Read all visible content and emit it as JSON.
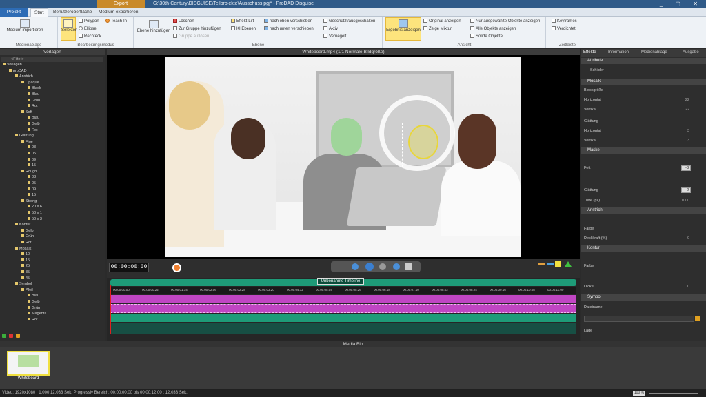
{
  "titlebar": {
    "context_tab": "Export",
    "title": "G:\\30th-Century\\DISGUISE\\Teilprojekte\\Ausschuss.pgj* - ProDAD Disguise",
    "window_controls": "_ ▢ ✕"
  },
  "tabs": [
    {
      "label": "Projekt"
    },
    {
      "label": "Start"
    },
    {
      "label": "Benutzeroberfläche"
    },
    {
      "label": "Medium exportieren"
    }
  ],
  "ribbon": {
    "media_import": "Medium importieren",
    "group_media": "Medienablage",
    "selector": "Selektor",
    "polygon": "Polygon",
    "ellipse": "Ellipse",
    "rect": "Rechteck",
    "teach": "Teach-In",
    "group_edit": "Bearbeitungsmodus",
    "add_layer": "Ebene hinzufügen",
    "delete": "Löschen",
    "group_add": "Zur Gruppe hinzufügen",
    "group_remove": "Gruppe auflösen",
    "effect_lift": "Effekt-Lift",
    "ki_layers": "KI Ebenen",
    "move_up": "nach oben verschieben",
    "move_down": "nach unten verschieben",
    "locked_hidden": "Geschützt/ausgeschalten",
    "active": "Aktiv",
    "locked": "Verriegelt",
    "group_layer": "Ebene",
    "show_result": "Ergebnis anzeigen",
    "show_original": "Original anzeigen",
    "show_mix": "Zeige Mixtur",
    "only_selected": "Nur ausgewählte Objekte anzeigen",
    "all_objects": "Alle Objekte anzeigen",
    "solo_objects": "Solide Objekte",
    "group_view": "Ansicht",
    "keyframes": "Keyframes",
    "stretch": "Verdichtet",
    "group_time": "Zeitleiste"
  },
  "left_panel": {
    "title": "Vorlagen",
    "filter": "<Filter>",
    "tree": [
      {
        "label": "Vorlagen",
        "depth": 0
      },
      {
        "label": "proDAD",
        "depth": 1
      },
      {
        "label": "Anstrich",
        "depth": 2
      },
      {
        "label": "Opaque",
        "depth": 3
      },
      {
        "label": "Black",
        "depth": 4
      },
      {
        "label": "Blau",
        "depth": 4
      },
      {
        "label": "Grün",
        "depth": 4
      },
      {
        "label": "Rot",
        "depth": 4
      },
      {
        "label": "Soft",
        "depth": 3
      },
      {
        "label": "Blau",
        "depth": 4
      },
      {
        "label": "Gelb",
        "depth": 4
      },
      {
        "label": "Rot",
        "depth": 4
      },
      {
        "label": "Glättung",
        "depth": 2
      },
      {
        "label": "Fine",
        "depth": 3
      },
      {
        "label": "03",
        "depth": 4
      },
      {
        "label": "05",
        "depth": 4
      },
      {
        "label": "09",
        "depth": 4
      },
      {
        "label": "15",
        "depth": 4
      },
      {
        "label": "Rough",
        "depth": 3
      },
      {
        "label": "03",
        "depth": 4
      },
      {
        "label": "05",
        "depth": 4
      },
      {
        "label": "09",
        "depth": 4
      },
      {
        "label": "15",
        "depth": 4
      },
      {
        "label": "Strong",
        "depth": 3
      },
      {
        "label": "20 x 6",
        "depth": 4
      },
      {
        "label": "50 x 1",
        "depth": 4
      },
      {
        "label": "50 x 3",
        "depth": 4
      },
      {
        "label": "Kontur",
        "depth": 2
      },
      {
        "label": "Gelb",
        "depth": 3
      },
      {
        "label": "Grün",
        "depth": 3
      },
      {
        "label": "Rot",
        "depth": 3
      },
      {
        "label": "Mosaik",
        "depth": 2
      },
      {
        "label": "10",
        "depth": 3
      },
      {
        "label": "15",
        "depth": 3
      },
      {
        "label": "25",
        "depth": 3
      },
      {
        "label": "35",
        "depth": 3
      },
      {
        "label": "45",
        "depth": 3
      },
      {
        "label": "Symbol",
        "depth": 2
      },
      {
        "label": "Pfeil",
        "depth": 3
      },
      {
        "label": "Blau",
        "depth": 4
      },
      {
        "label": "Gelb",
        "depth": 4
      },
      {
        "label": "Grün",
        "depth": 4
      },
      {
        "label": "Magenta",
        "depth": 4
      },
      {
        "label": "Rot",
        "depth": 4
      }
    ]
  },
  "viewer": {
    "title": "Whiteboard.mp4  (1/1  Normale-Bildgröße)",
    "timecode": "00:00:00:00"
  },
  "timeline": {
    "title": "Unbenannte Timeline",
    "ticks": [
      "00:00:00:00",
      "00:00:00:22",
      "00:00:01:14",
      "00:00:02:06",
      "00:00:02:28",
      "00:00:03:20",
      "00:00:04:12",
      "00:00:05:04",
      "00:00:05:26",
      "00:00:06:18",
      "00:00:07:10",
      "00:00:08:02",
      "00:00:08:24",
      "00:00:09:16",
      "00:00:10:08",
      "00:00:11:00"
    ]
  },
  "right_panel": {
    "tabs": [
      "Effekte",
      "Information",
      "Medienablage",
      "Ausgabe"
    ],
    "attr_header": "Attribute",
    "layer_name": "Schilder",
    "sections": {
      "mosaik": "Mosaik",
      "blocksize": "Blockgröße",
      "horizontal": "Horizontal",
      "vertical": "Vertikal",
      "smoothing": "Glättung",
      "maske": "Maske",
      "fett": "Fett",
      "glaettung": "Glättung",
      "tiefe": "Tiefe (px)",
      "anstrich": "Anstrich",
      "farbe": "Farbe",
      "deckkraft": "Deckkraft (%)",
      "kontur": "Kontur",
      "dicke": "Dicke",
      "symbol": "Symbol",
      "dateiname": "Dateiname",
      "lage": "Lage"
    },
    "values": {
      "h1": "22",
      "v1": "22",
      "h2": "3",
      "v2": "3",
      "fett": "-3",
      "glaettung": "2",
      "tiefe": "1000",
      "deckkraft": "0",
      "dicke": "0"
    }
  },
  "mediabin": {
    "title": "Media Bin",
    "item": "Whiteboard"
  },
  "status": {
    "text": "Video: 1920x1080 : 1,000   12,033 Sek.   Progressiv   Bereich: 00:00:00:00 bis 00:00:12:00 : 12,033 Sek.",
    "zoom": "100 %"
  },
  "colors": {
    "accent": "#2d6cb5",
    "timeline_green": "#1e9b78",
    "track_magenta": "#c046c3",
    "highlight": "#fde47d"
  }
}
